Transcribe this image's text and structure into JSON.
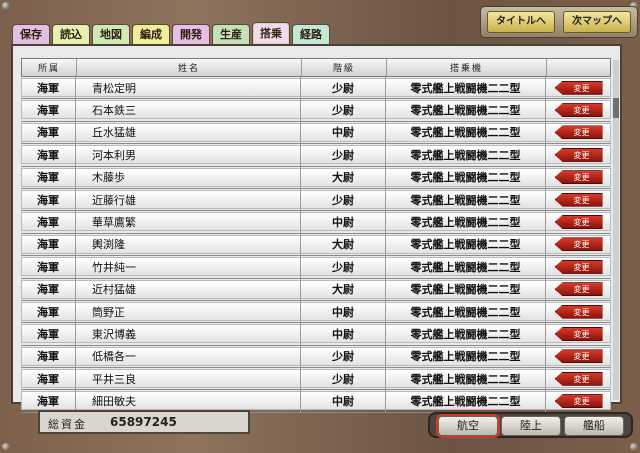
{
  "tabs": [
    {
      "label": "保存",
      "color": "#e3bfe0"
    },
    {
      "label": "読込",
      "color": "#e7f0b0"
    },
    {
      "label": "地図",
      "color": "#cfe9b5"
    },
    {
      "label": "編成",
      "color": "#f1ee9a"
    },
    {
      "label": "開発",
      "color": "#e9bde4"
    },
    {
      "label": "生産",
      "color": "#c4e1b7"
    },
    {
      "label": "搭乗",
      "color": "#f2dbe8",
      "active": true
    },
    {
      "label": "経路",
      "color": "#c3e9d2"
    }
  ],
  "top_buttons": {
    "title": "タイトルへ",
    "next_map": "次マップへ"
  },
  "table": {
    "headers": [
      "所属",
      "姓名",
      "階級",
      "搭乗機",
      ""
    ],
    "change_label": "変更",
    "rows": [
      {
        "affiliation": "海軍",
        "name": "青松定明",
        "rank": "少尉",
        "aircraft": "零式艦上戦闘機二二型"
      },
      {
        "affiliation": "海軍",
        "name": "石本鉄三",
        "rank": "少尉",
        "aircraft": "零式艦上戦闘機二二型"
      },
      {
        "affiliation": "海軍",
        "name": "丘水猛雄",
        "rank": "中尉",
        "aircraft": "零式艦上戦闘機二二型"
      },
      {
        "affiliation": "海軍",
        "name": "河本利男",
        "rank": "少尉",
        "aircraft": "零式艦上戦闘機二二型"
      },
      {
        "affiliation": "海軍",
        "name": "木藤歩",
        "rank": "大尉",
        "aircraft": "零式艦上戦闘機二二型"
      },
      {
        "affiliation": "海軍",
        "name": "近藤行雄",
        "rank": "少尉",
        "aircraft": "零式艦上戦闘機二二型"
      },
      {
        "affiliation": "海軍",
        "name": "華草鷹繁",
        "rank": "中尉",
        "aircraft": "零式艦上戦闘機二二型"
      },
      {
        "affiliation": "海軍",
        "name": "輿渕隆",
        "rank": "大尉",
        "aircraft": "零式艦上戦闘機二二型"
      },
      {
        "affiliation": "海軍",
        "name": "竹井純一",
        "rank": "少尉",
        "aircraft": "零式艦上戦闘機二二型"
      },
      {
        "affiliation": "海軍",
        "name": "近村猛雄",
        "rank": "大尉",
        "aircraft": "零式艦上戦闘機二二型"
      },
      {
        "affiliation": "海軍",
        "name": "筒野正",
        "rank": "中尉",
        "aircraft": "零式艦上戦闘機二二型"
      },
      {
        "affiliation": "海軍",
        "name": "東沢博義",
        "rank": "中尉",
        "aircraft": "零式艦上戦闘機二二型"
      },
      {
        "affiliation": "海軍",
        "name": "低橋各一",
        "rank": "少尉",
        "aircraft": "零式艦上戦闘機二二型"
      },
      {
        "affiliation": "海軍",
        "name": "平井三良",
        "rank": "少尉",
        "aircraft": "零式艦上戦闘機二二型"
      },
      {
        "affiliation": "海軍",
        "name": "細田敏夫",
        "rank": "中尉",
        "aircraft": "零式艦上戦闘機二二型"
      }
    ]
  },
  "funds": {
    "label": "総資金",
    "value": "65897245"
  },
  "bottom_buttons": [
    "航空",
    "陸上",
    "艦船"
  ]
}
